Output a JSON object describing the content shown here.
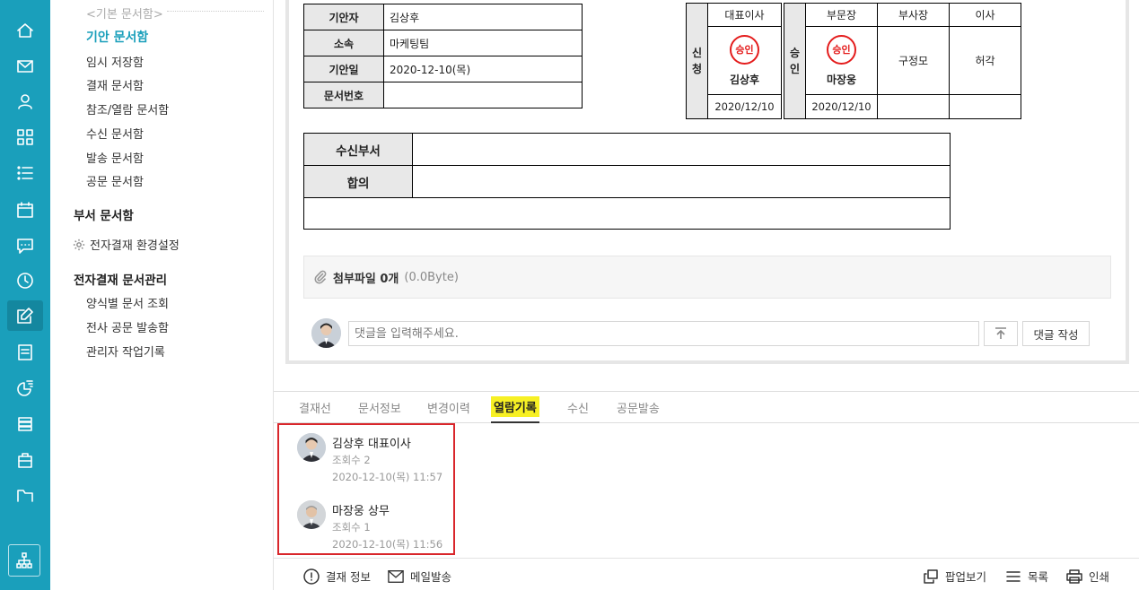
{
  "nav": {
    "group_label": "<기본 문서함>",
    "items": [
      {
        "label": "기안 문서함",
        "active": true
      },
      {
        "label": "임시 저장함"
      },
      {
        "label": "결재 문서함"
      },
      {
        "label": "참조/열람 문서함"
      },
      {
        "label": "수신 문서함"
      },
      {
        "label": "발송 문서함"
      },
      {
        "label": "공문 문서함"
      }
    ],
    "dept_label": "부서 문서함",
    "settings_label": "전자결재 환경설정",
    "admin_label": "전자결재 문서관리",
    "admin_items": [
      {
        "label": "양식별 문서 조회"
      },
      {
        "label": "전사 공문 발송함"
      },
      {
        "label": "관리자 작업기록"
      }
    ]
  },
  "doc": {
    "info": [
      {
        "label": "기안자",
        "value": "김상후"
      },
      {
        "label": "소속",
        "value": "마케팅팀"
      },
      {
        "label": "기안일",
        "value": "2020-12-10(목)"
      },
      {
        "label": "문서번호",
        "value": ""
      }
    ],
    "apply": {
      "side": [
        "신",
        "청"
      ],
      "header": "대표이사",
      "stamp": "승인",
      "name": "김상후",
      "date": "2020/12/10"
    },
    "approve": {
      "side": [
        "승",
        "인"
      ],
      "headers": [
        "부문장",
        "부사장",
        "이사"
      ],
      "stamp": "승인",
      "name": "마장웅",
      "date": "2020/12/10",
      "plain_names": [
        "구정모",
        "허각"
      ]
    },
    "receive_label": "수신부서",
    "agree_label": "합의",
    "attach_label": "첨부파일 0개",
    "attach_size": "(0.0Byte)",
    "comment_placeholder": "댓글을 입력해주세요.",
    "comment_submit": "댓글 작성"
  },
  "tabs": [
    {
      "label": "결재선"
    },
    {
      "label": "문서정보"
    },
    {
      "label": "변경이력"
    },
    {
      "label": "열람기록",
      "active": true
    },
    {
      "label": "수신"
    },
    {
      "label": "공문발송"
    }
  ],
  "records": [
    {
      "name": "김상후 대표이사",
      "views": "조회수 2",
      "time": "2020-12-10(목) 11:57"
    },
    {
      "name": "마장웅 상무",
      "views": "조회수 1",
      "time": "2020-12-10(목) 11:56"
    }
  ],
  "bottom": {
    "left": [
      {
        "label": "결재 정보"
      },
      {
        "label": "메일발송"
      }
    ],
    "right": [
      {
        "label": "팝업보기"
      },
      {
        "label": "목록"
      },
      {
        "label": "인쇄"
      }
    ]
  },
  "colors": {
    "rail": "#1a9fbb",
    "accent": "#1a9fbb",
    "stamp": "#e41c1c",
    "highlight": "#f7f024",
    "record_border": "#d9262b"
  }
}
